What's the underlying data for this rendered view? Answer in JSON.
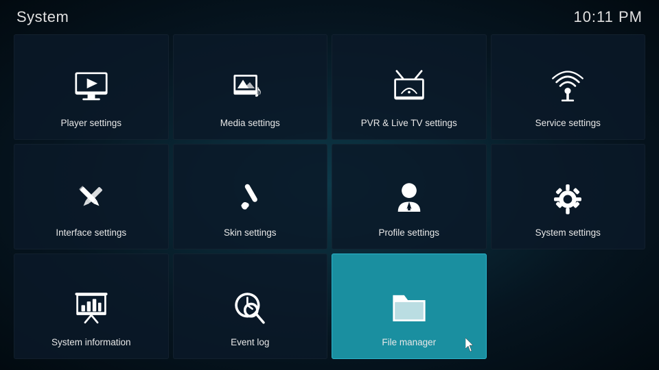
{
  "header": {
    "title": "System",
    "time": "10:11 PM"
  },
  "tiles": [
    {
      "id": "player-settings",
      "label": "Player settings",
      "icon": "player",
      "active": false
    },
    {
      "id": "media-settings",
      "label": "Media settings",
      "icon": "media",
      "active": false
    },
    {
      "id": "pvr-settings",
      "label": "PVR & Live TV settings",
      "icon": "pvr",
      "active": false
    },
    {
      "id": "service-settings",
      "label": "Service settings",
      "icon": "service",
      "active": false
    },
    {
      "id": "interface-settings",
      "label": "Interface settings",
      "icon": "interface",
      "active": false
    },
    {
      "id": "skin-settings",
      "label": "Skin settings",
      "icon": "skin",
      "active": false
    },
    {
      "id": "profile-settings",
      "label": "Profile settings",
      "icon": "profile",
      "active": false
    },
    {
      "id": "system-settings",
      "label": "System settings",
      "icon": "system",
      "active": false
    },
    {
      "id": "system-information",
      "label": "System information",
      "icon": "sysinfo",
      "active": false
    },
    {
      "id": "event-log",
      "label": "Event log",
      "icon": "eventlog",
      "active": false
    },
    {
      "id": "file-manager",
      "label": "File manager",
      "icon": "filemanager",
      "active": true
    }
  ]
}
